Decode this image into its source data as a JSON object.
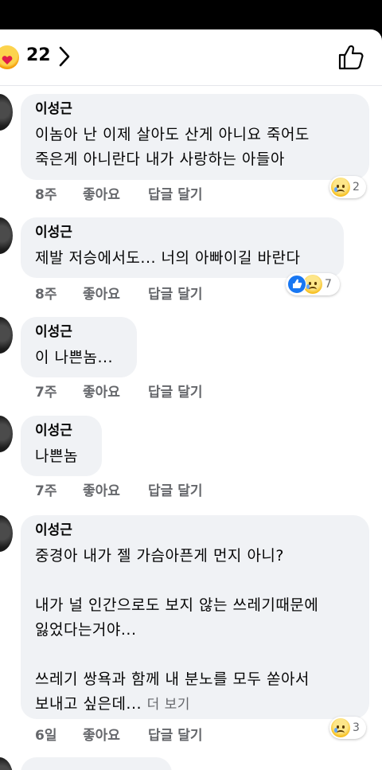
{
  "header": {
    "reaction_icon": "heart-hug-emoji",
    "reaction_count": "22",
    "chevron_icon": "chevron-right-icon",
    "like_icon": "thumbs-up-icon"
  },
  "comments": [
    {
      "author": "이성근",
      "text": "이놈아 난 이제 살아도 산게 아니요 죽어도\n죽은게 아니란다 내가 사랑하는 아들아",
      "time": "8주",
      "like": "좋아요",
      "reply": "답글 달기",
      "reactions": [
        "sad"
      ],
      "reaction_count": "2"
    },
    {
      "author": "이성근",
      "text": "제발 저승에서도... 너의 아빠이길 바란다",
      "time": "8주",
      "like": "좋아요",
      "reply": "답글 달기",
      "reactions": [
        "like",
        "sad"
      ],
      "reaction_count": "7"
    },
    {
      "author": "이성근",
      "text": "이 나쁜놈...",
      "time": "7주",
      "like": "좋아요",
      "reply": "답글 달기",
      "reactions": [],
      "reaction_count": ""
    },
    {
      "author": "이성근",
      "text": "나쁜놈",
      "time": "7주",
      "like": "좋아요",
      "reply": "답글 달기",
      "reactions": [],
      "reaction_count": ""
    },
    {
      "author": "이성근",
      "text": "중경아 내가 젤 가슴아픈게 먼지 아니?\n\n내가 널 인간으로도 보지 않는 쓰레기때문에\n잃었다는거야...\n\n쓰레기 쌍욕과 함께 내 분노를 모두 쏟아서\n보내고 싶은데... ",
      "more": "더 보기",
      "time": "6일",
      "like": "좋아요",
      "reply": "답글 달기",
      "reactions": [
        "sad"
      ],
      "reaction_count": "3"
    }
  ]
}
